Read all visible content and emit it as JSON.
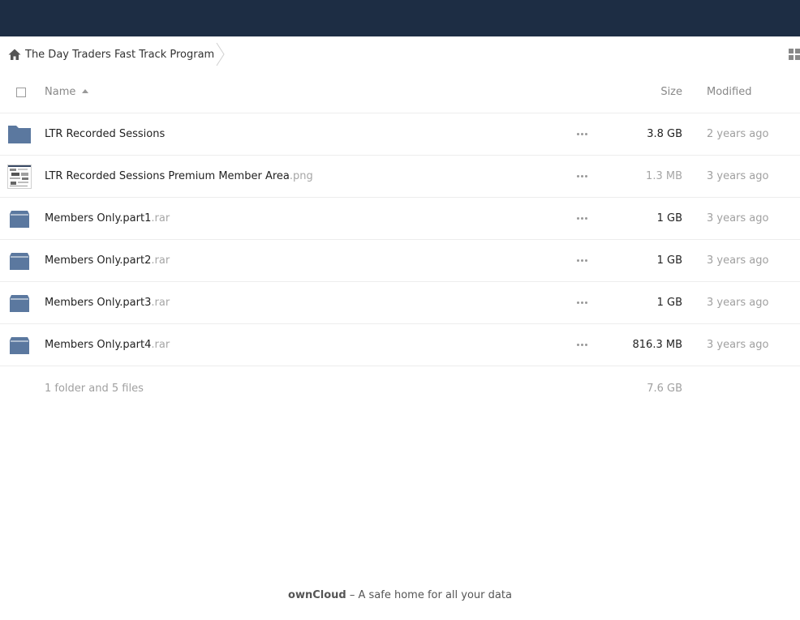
{
  "breadcrumb": {
    "current": "The Day Traders Fast Track Program"
  },
  "table": {
    "header": {
      "name": "Name",
      "size": "Size",
      "modified": "Modified"
    },
    "rows": [
      {
        "name": "LTR Recorded Sessions",
        "ext": "",
        "size": "3.8 GB",
        "modified": "2 years ago",
        "icon": "folder-icon"
      },
      {
        "name": "LTR Recorded Sessions Premium Member Area",
        "ext": ".png",
        "size": "1.3 MB",
        "modified": "3 years ago",
        "icon": "image-thumbnail"
      },
      {
        "name": "Members Only.part1",
        "ext": ".rar",
        "size": "1 GB",
        "modified": "3 years ago",
        "icon": "archive-icon"
      },
      {
        "name": "Members Only.part2",
        "ext": ".rar",
        "size": "1 GB",
        "modified": "3 years ago",
        "icon": "archive-icon"
      },
      {
        "name": "Members Only.part3",
        "ext": ".rar",
        "size": "1 GB",
        "modified": "3 years ago",
        "icon": "archive-icon"
      },
      {
        "name": "Members Only.part4",
        "ext": ".rar",
        "size": "816.3 MB",
        "modified": "3 years ago",
        "icon": "archive-icon"
      }
    ]
  },
  "summary": {
    "count": "1 folder and 5 files",
    "total_size": "7.6 GB"
  },
  "footer": {
    "brand": "ownCloud",
    "tagline": " – A safe home for all your data"
  },
  "colors": {
    "header_bar": "#1d2d44",
    "folder_blue": "#5b789f",
    "size_large": "#222222",
    "size_small": "#a6a6a6"
  }
}
